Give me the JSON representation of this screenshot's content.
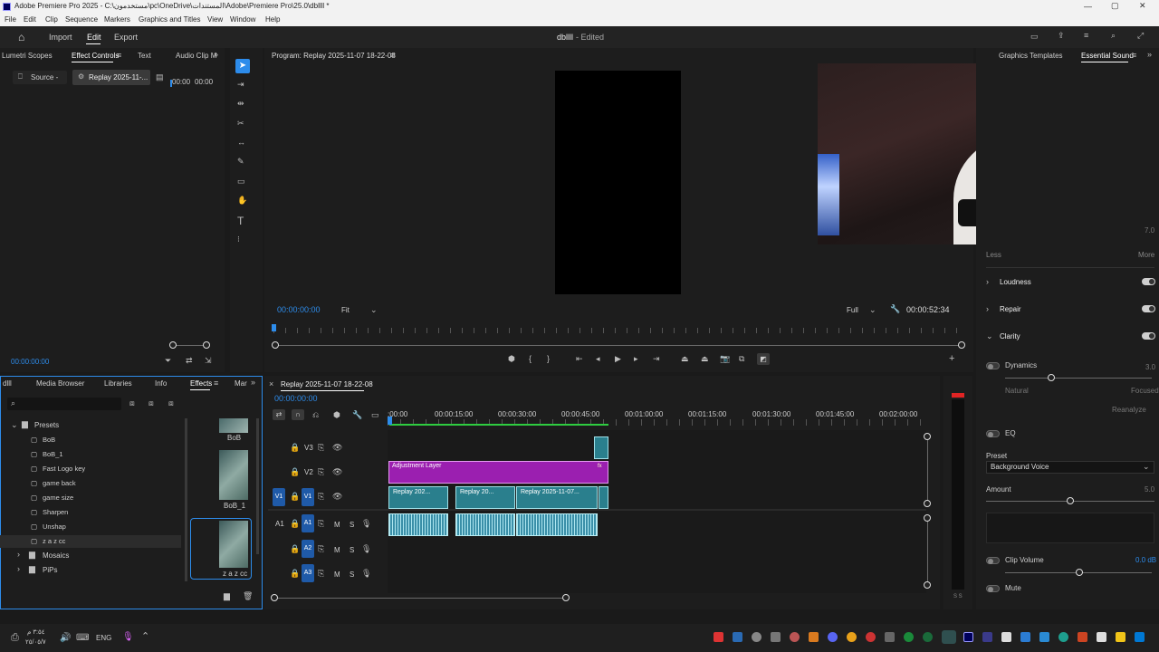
{
  "titlebar": {
    "title": "Adobe Premiere Pro 2025 - C:\\مستخدمون\\pc\\OneDrive\\المستندات\\Adobe\\Premiere Pro\\25.0\\dbllll *"
  },
  "menu": [
    "File",
    "Edit",
    "Clip",
    "Sequence",
    "Markers",
    "Graphics and Titles",
    "View",
    "Window",
    "Help"
  ],
  "header": {
    "nav": [
      "Import",
      "Edit",
      "Export"
    ],
    "project_title": "dbllll",
    "status": "- Edited"
  },
  "left_panel": {
    "tabs": [
      "Lumetri Scopes",
      "Effect Controls",
      "Text",
      "Audio Clip M"
    ],
    "source_chip": "Source -",
    "clip_chip": "Replay 2025-11-...",
    "ruler_a": "00:00",
    "ruler_b": "00:00",
    "timecode": "00:00:00:00"
  },
  "program": {
    "title": "Program: Replay 2025-11-07 18-22-08",
    "timecode": "00:00:00:00",
    "fit": "Fit",
    "quality": "Full",
    "duration": "00:00:52:34"
  },
  "effects": {
    "tabs": [
      "Media Browser",
      "Libraries",
      "Info",
      "Effects",
      "Mar"
    ],
    "clipped_label": "dlll",
    "presets_label": "Presets",
    "items": [
      "BoB",
      "BoB_1",
      "Fast Logo key",
      "game back",
      "game size",
      "Sharpen",
      "Unshap",
      "z a z cc"
    ],
    "folders": [
      "Mosaics",
      "PiPs"
    ],
    "thumbs": [
      "BoB",
      "BoB_1",
      "z a z cc"
    ]
  },
  "timeline": {
    "tab": "Replay 2025-11-07 18-22-08",
    "timecode": "00:00:00:00",
    "ruler": [
      ":00:00",
      "00:00:15:00",
      "00:00:30:00",
      "00:00:45:00",
      "00:01:00:00",
      "00:01:15:00",
      "00:01:30:00",
      "00:01:45:00",
      "00:02:00:00"
    ],
    "video_tracks": [
      "V3",
      "V2",
      "V1"
    ],
    "audio_tracks": [
      "A1",
      "A2",
      "A3"
    ],
    "source_v": "V1",
    "source_a": "A1",
    "adjustment_label": "Adjustment Layer",
    "clip_labels": [
      "Replay 202...",
      "Replay 20...",
      "Replay 2025-11-07..."
    ],
    "meter_labels": "S S"
  },
  "essential_sound": {
    "tabs": [
      "Graphics Templates",
      "Essential Sound"
    ],
    "less": "Less",
    "more": "More",
    "scale_7": "7.0",
    "loudness": "Loudness",
    "repair": "Repair",
    "clarity": "Clarity",
    "dynamics": "Dynamics",
    "dynamics_value": "3.0",
    "natural": "Natural",
    "focused": "Focused",
    "reanalyze": "Reanalyze",
    "eq": "EQ",
    "preset_label": "Preset",
    "preset_value": "Background Voice",
    "amount": "Amount",
    "amount_value": "5.0",
    "clip_volume": "Clip Volume",
    "clip_volume_value": "0.0 dB",
    "mute": "Mute"
  },
  "taskbar": {
    "time": "٣:٥٤ م",
    "date": "٢٥/٠٥/٧",
    "lang": "ENG"
  },
  "colors": {
    "accent": "#2d8ceb",
    "adjustment": "#9b1fb0",
    "clip": "#2a7f8d"
  }
}
